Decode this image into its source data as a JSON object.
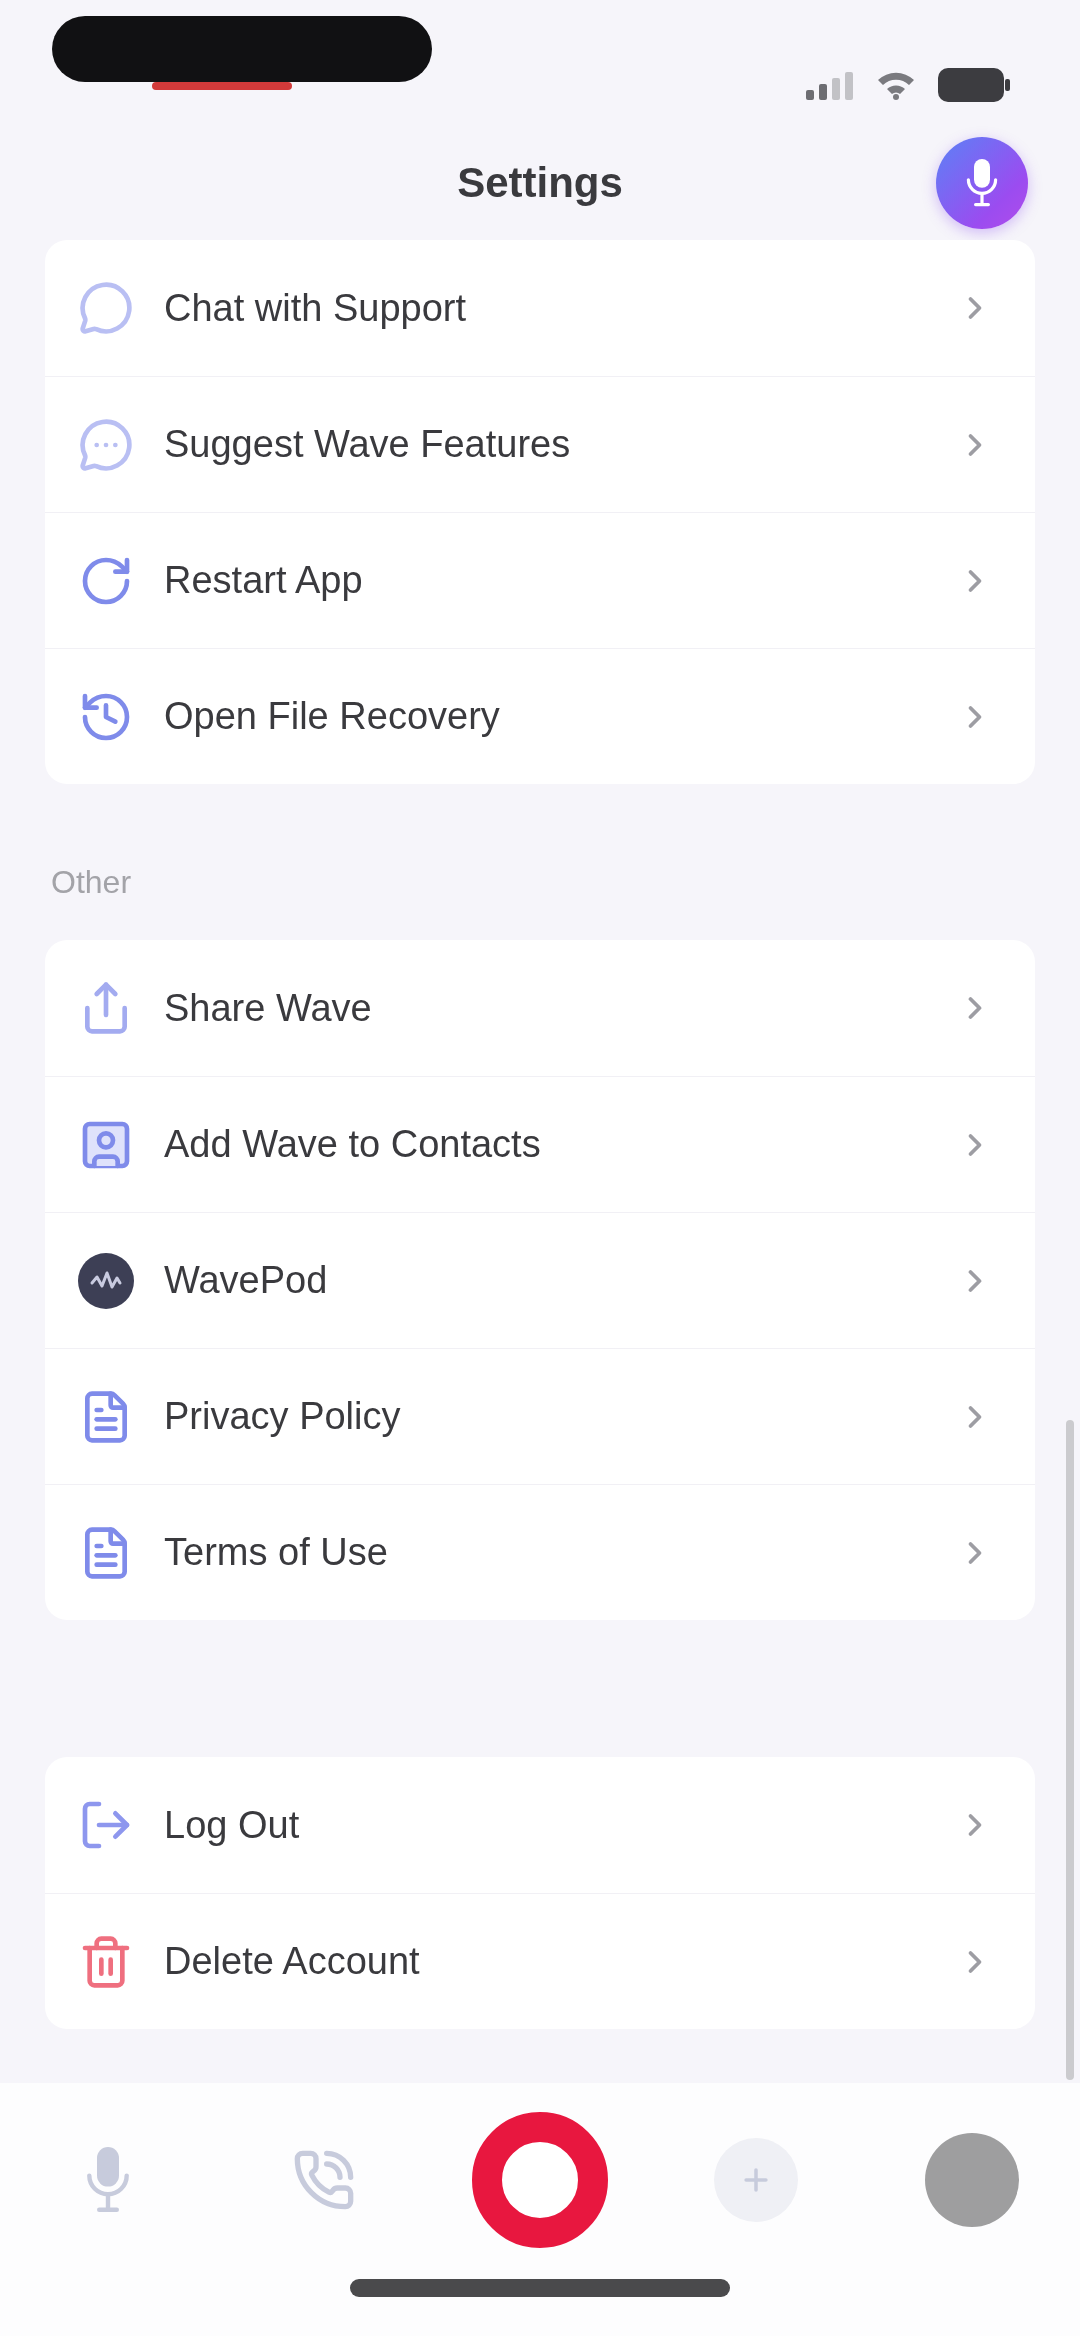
{
  "header": {
    "title": "Settings"
  },
  "sections": [
    {
      "items": [
        {
          "label": "Chat with Support"
        },
        {
          "label": "Suggest Wave Features"
        },
        {
          "label": "Restart App"
        },
        {
          "label": "Open File Recovery"
        }
      ]
    },
    {
      "heading": "Other",
      "items": [
        {
          "label": "Share Wave"
        },
        {
          "label": "Add Wave to Contacts"
        },
        {
          "label": "WavePod"
        },
        {
          "label": "Privacy Policy"
        },
        {
          "label": "Terms of Use"
        }
      ]
    },
    {
      "items": [
        {
          "label": "Log Out"
        },
        {
          "label": "Delete Account"
        }
      ]
    }
  ]
}
